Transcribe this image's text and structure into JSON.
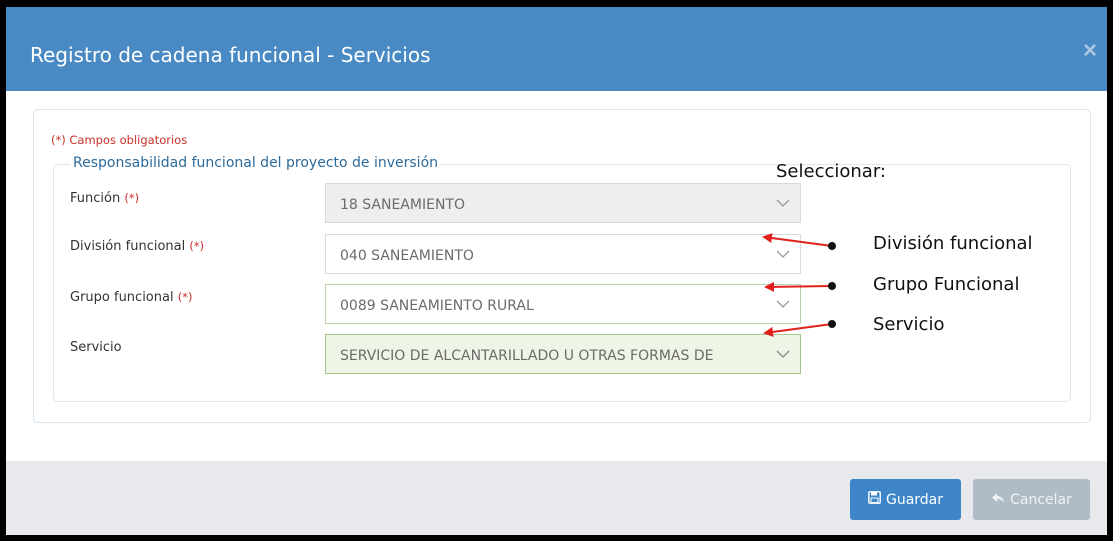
{
  "modal": {
    "title": "Registro de cadena funcional - Servicios",
    "close": "×"
  },
  "form": {
    "required_note": "(*) Campos obligatorios",
    "legend": "Responsabilidad funcional del proyecto de inversión",
    "required_mark": "(*)",
    "fields": [
      {
        "label": "Función",
        "value": "18 SANEAMIENTO",
        "required": true,
        "state": "disabled"
      },
      {
        "label": "División funcional",
        "value": "040 SANEAMIENTO",
        "required": true,
        "state": "normal"
      },
      {
        "label": "Grupo funcional",
        "value": "0089 SANEAMIENTO RURAL",
        "required": true,
        "state": "valid"
      },
      {
        "label": "Servicio",
        "value": "SERVICIO DE ALCANTARILLADO U OTRAS FORMAS DE",
        "required": false,
        "state": "valid-filled"
      }
    ]
  },
  "annotation": {
    "heading": "Seleccionar:",
    "items": [
      "División funcional",
      "Grupo Funcional",
      "Servicio"
    ],
    "arrow_color": "#e0201c"
  },
  "footer": {
    "save_label": "Guardar",
    "cancel_label": "Cancelar"
  },
  "colors": {
    "header": "#4a8ac4",
    "primary_button": "#3e86c9",
    "disabled_button": "#b0bcc5",
    "required": "#c9302c"
  },
  "icons": {
    "close": "close-icon",
    "chevron": "chevron-down-icon",
    "save": "floppy-disk-icon",
    "cancel": "reply-arrow-icon"
  }
}
